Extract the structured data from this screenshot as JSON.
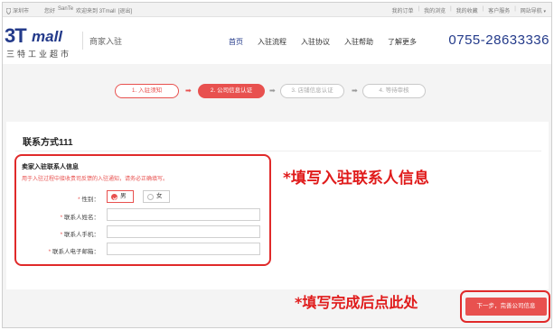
{
  "topbar": {
    "location": "深圳市",
    "greeting": "您好",
    "username": "SanTe",
    "welcome": "欢迎来到 3Tmall",
    "logout": "[退出]",
    "links": [
      "我的订单",
      "我的浏览",
      "我的收藏",
      "客户服务",
      "网站导航"
    ]
  },
  "header": {
    "logo_mark": "3T",
    "logo_text": "mall",
    "logo_sub": "三特工业超市",
    "section": "商家入驻",
    "nav": [
      "首页",
      "入驻流程",
      "入驻协议",
      "入驻帮助",
      "了解更多"
    ],
    "phone": "0755-28633336"
  },
  "steps": [
    {
      "label": "1. 入驻须知",
      "state": "done"
    },
    {
      "label": "2. 公司信息认证",
      "state": "active"
    },
    {
      "label": "3. 店铺信息认证",
      "state": "pending"
    },
    {
      "label": "4. 等待审核",
      "state": "pending"
    }
  ],
  "form": {
    "section_title": "联系方式111",
    "subtitle": "卖家入驻联系人信息",
    "hint": "用于入驻过程中接收贵司反馈的入驻通知，请务必正确填写。",
    "gender_label": "性别：",
    "gender_male": "男",
    "gender_female": "女",
    "name_label": "联系人姓名：",
    "phone_label": "联系人手机：",
    "email_label": "联系人电子邮箱：",
    "required_mark": "*"
  },
  "annotations": {
    "fill_contact": "*填写入驻联系人信息",
    "after_fill": "*填写完成后点此处"
  },
  "actions": {
    "next": "下一步，完善公司信息"
  },
  "colors": {
    "accent": "#e8514f",
    "brand": "#233a8a",
    "annotation": "#e01b1b"
  }
}
